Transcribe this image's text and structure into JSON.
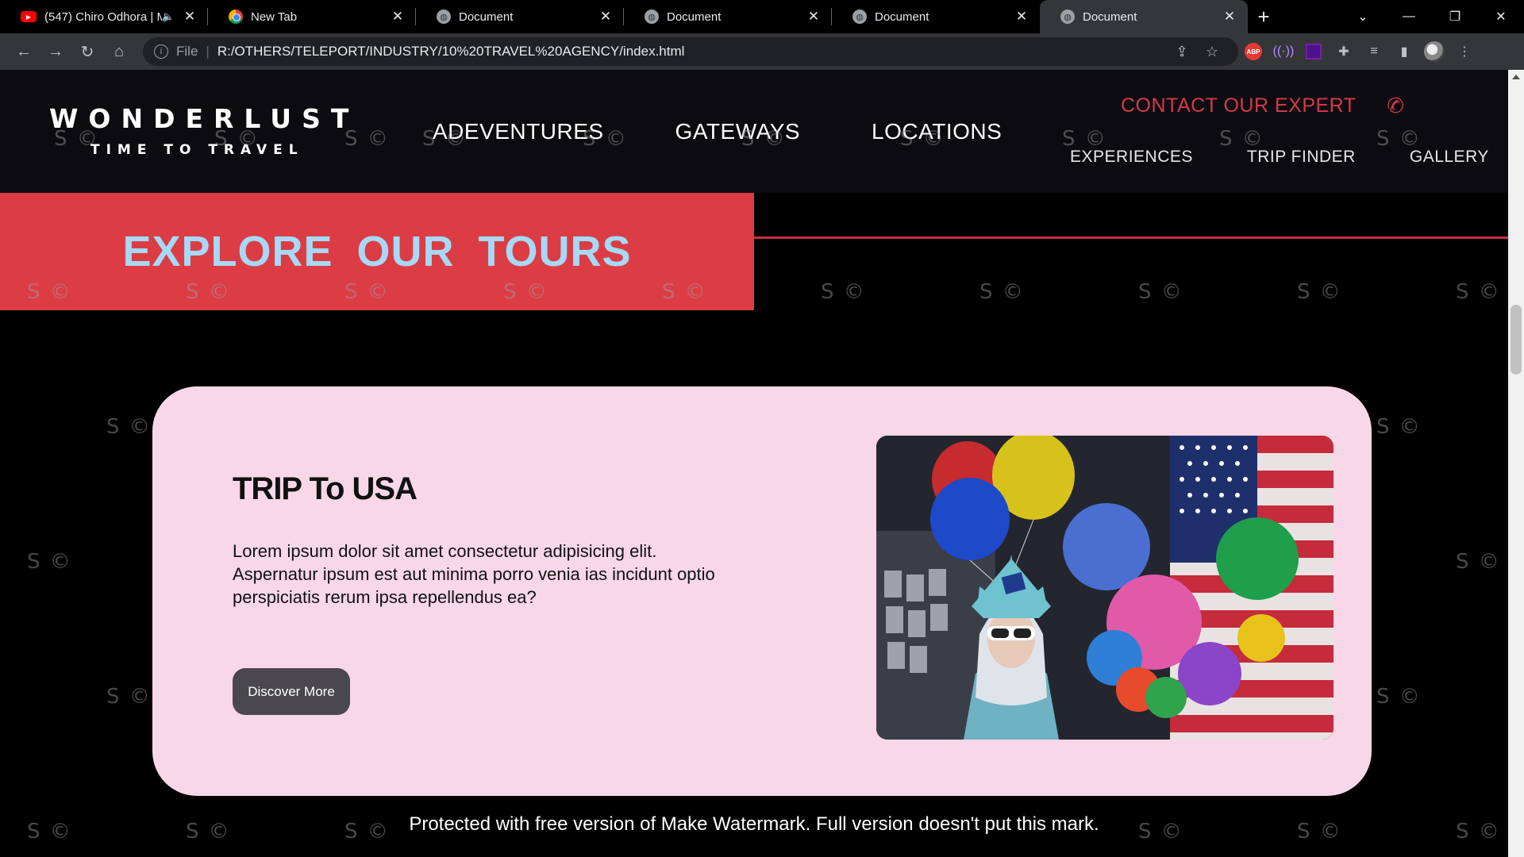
{
  "browser": {
    "tabs": [
      {
        "title": "(547) Chiro Odhora | M",
        "icon": "youtube-icon",
        "audio": true
      },
      {
        "title": "New Tab",
        "icon": "chrome-icon"
      },
      {
        "title": "Document",
        "icon": "globe-icon"
      },
      {
        "title": "Document",
        "icon": "globe-icon"
      },
      {
        "title": "Document",
        "icon": "globe-icon"
      },
      {
        "title": "Document",
        "icon": "globe-icon",
        "active": true
      }
    ],
    "address": {
      "scheme": "File",
      "url": "R:/OTHERS/TELEPORT/INDUSTRY/10%20TRAVEL%20AGENCY/index.html"
    },
    "extensions": {
      "abp": "ABP"
    }
  },
  "site": {
    "logo": {
      "name": "WONDERLUST",
      "tagline": "TIME TO TRAVEL"
    },
    "main_nav": [
      "ADEVENTURES",
      "GATEWAYS",
      "LOCATIONS"
    ],
    "contact": "CONTACT OUR EXPERT",
    "sub_nav": [
      "EXPERIENCES",
      "TRIP FINDER",
      "GALLERY"
    ],
    "banner": {
      "title": "EXPLORE OUR TOURS"
    },
    "card": {
      "title": "TRIP To USA",
      "body": "Lorem ipsum dolor sit amet consectetur adipisicing elit. Aspernatur ipsum est aut minima porro venia ias incidunt optio perspiciatis rerum ipsa repellendus ea?",
      "button": "Discover More"
    },
    "watermark_notice": "Protected with free version of Make Watermark. Full version doesn't put this mark.",
    "watermark_mark": "S ©"
  },
  "colors": {
    "accent_red": "#dc3d45",
    "banner_text": "#a6d9f7",
    "card_bg": "#f8d7e8",
    "contact_red": "#d6384d"
  }
}
